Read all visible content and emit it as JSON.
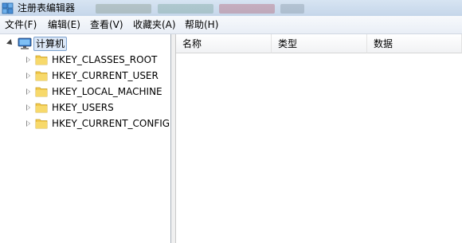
{
  "window": {
    "title": "注册表编辑器",
    "icon": "registry-editor-icon",
    "ghost_items": [
      "ghost-1",
      "ghost-2",
      "ghost-3",
      "ghost-4"
    ]
  },
  "menu": {
    "items": [
      {
        "label": "文件(F)"
      },
      {
        "label": "编辑(E)"
      },
      {
        "label": "查看(V)"
      },
      {
        "label": "收藏夹(A)"
      },
      {
        "label": "帮助(H)"
      }
    ]
  },
  "tree": {
    "root": {
      "label": "计算机",
      "icon": "computer-icon",
      "expanded": true,
      "selected": true
    },
    "keys": [
      {
        "label": "HKEY_CLASSES_ROOT",
        "icon": "folder-icon"
      },
      {
        "label": "HKEY_CURRENT_USER",
        "icon": "folder-icon"
      },
      {
        "label": "HKEY_LOCAL_MACHINE",
        "icon": "folder-icon"
      },
      {
        "label": "HKEY_USERS",
        "icon": "folder-icon"
      },
      {
        "label": "HKEY_CURRENT_CONFIG",
        "icon": "folder-icon"
      }
    ]
  },
  "list": {
    "columns": [
      {
        "label": "名称"
      },
      {
        "label": "类型"
      },
      {
        "label": "数据"
      }
    ]
  },
  "colors": {
    "titlebar": "#c5d6ea",
    "folder": "#f2c94c",
    "selection": "#dce8f7"
  }
}
